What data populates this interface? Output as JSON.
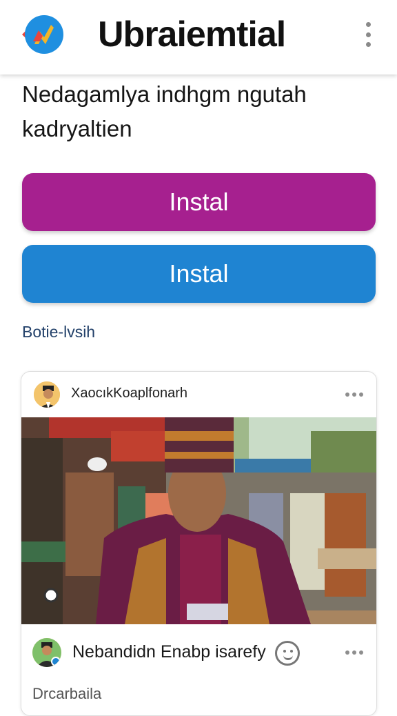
{
  "app": {
    "title": "Ubraiemtial",
    "logo_icon": "chart-logo-icon",
    "menu_icon": "more-vertical-icon"
  },
  "headline": {
    "line1": "Nedagamlya indhgm ngutah",
    "line2": "kadryaltien"
  },
  "buttons": {
    "primary_label": "Instal",
    "secondary_label": "Instal",
    "primary_color": "#a6208f",
    "secondary_color": "#1f84d2"
  },
  "section_link": "Botie-lvsih",
  "post": {
    "author": "XaocıkKoaplfonarh",
    "footer_name": "Nebandidn Enabp isarefy",
    "footer_sub": "Drcarbaila",
    "icons": [
      "avatar",
      "more-horizontal-icon",
      "emoji-icon"
    ]
  }
}
